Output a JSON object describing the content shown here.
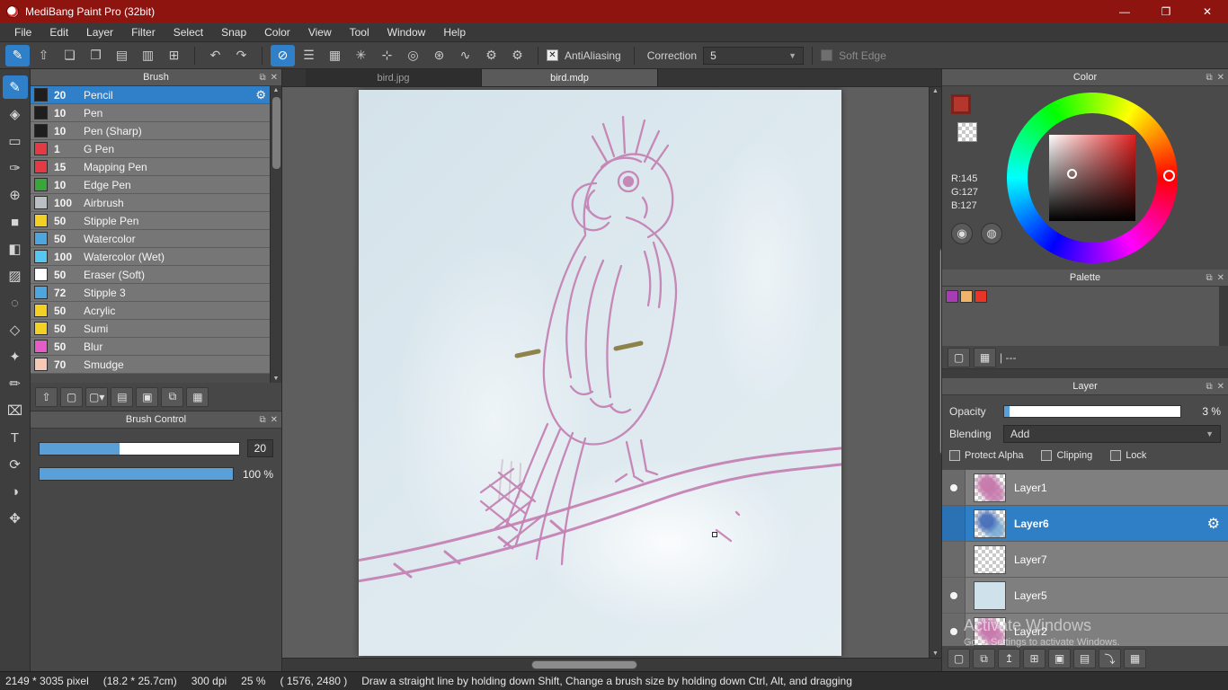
{
  "window": {
    "title": "MediBang Paint Pro (32bit)",
    "controls": {
      "minimize": "—",
      "maximize": "❐",
      "close": "✕"
    }
  },
  "menu": {
    "items": [
      "File",
      "Edit",
      "Layer",
      "Filter",
      "Select",
      "Snap",
      "Color",
      "View",
      "Tool",
      "Window",
      "Help"
    ]
  },
  "toolbar": {
    "left_icons": [
      {
        "name": "paint-icon",
        "glyph": "✎",
        "selected": true
      },
      {
        "name": "upload-icon",
        "glyph": "⇧"
      },
      {
        "name": "comment-icon",
        "glyph": "❏"
      },
      {
        "name": "chat-icon",
        "glyph": "❐"
      },
      {
        "name": "page-icon",
        "glyph": "▤"
      },
      {
        "name": "pages-icon",
        "glyph": "▥"
      },
      {
        "name": "table-icon",
        "glyph": "⊞"
      }
    ],
    "undo_icon": {
      "name": "undo-icon",
      "glyph": "↶"
    },
    "redo_icon": {
      "name": "redo-icon",
      "glyph": "↷"
    },
    "snap_icons": [
      {
        "name": "snap-off-icon",
        "glyph": "⊘",
        "selected": true
      },
      {
        "name": "snap-parallel-icon",
        "glyph": "☰"
      },
      {
        "name": "snap-grid-icon",
        "glyph": "▦"
      },
      {
        "name": "snap-cross-icon",
        "glyph": "✳"
      },
      {
        "name": "snap-vanishing-icon",
        "glyph": "⊹"
      },
      {
        "name": "snap-concentric-icon",
        "glyph": "◎"
      },
      {
        "name": "snap-radial-icon",
        "glyph": "⊛"
      },
      {
        "name": "snap-curve-icon",
        "glyph": "∿"
      },
      {
        "name": "snap-gear-icon",
        "glyph": "⚙"
      },
      {
        "name": "snap-settings-icon",
        "glyph": "⚙"
      }
    ],
    "antialiasing_label": "AntiAliasing",
    "antialiasing_checked": "✕",
    "correction_label": "Correction",
    "correction_value": "5",
    "soft_edge_label": "Soft Edge"
  },
  "toolstrip": {
    "tools": [
      {
        "name": "pen-tool",
        "glyph": "✎",
        "selected": true
      },
      {
        "name": "eraser-tool",
        "glyph": "◈"
      },
      {
        "name": "select-marquee-tool",
        "glyph": "▭"
      },
      {
        "name": "brush-tool",
        "glyph": "✑"
      },
      {
        "name": "move-tool",
        "glyph": "⊕"
      },
      {
        "name": "fill-rect-tool",
        "glyph": "■"
      },
      {
        "name": "bucket-tool",
        "glyph": "◧"
      },
      {
        "name": "gradient-tool",
        "glyph": "▨"
      },
      {
        "name": "select-lasso-tool",
        "glyph": "◌"
      },
      {
        "name": "select-polygon-tool",
        "glyph": "◇"
      },
      {
        "name": "magic-wand-tool",
        "glyph": "✦"
      },
      {
        "name": "select-pen-tool",
        "glyph": "✏"
      },
      {
        "name": "select-eraser-tool",
        "glyph": "⌧"
      },
      {
        "name": "text-tool",
        "glyph": "T"
      },
      {
        "name": "rotate-tool",
        "glyph": "⟳"
      },
      {
        "name": "eyedropper-tool",
        "glyph": "◑"
      },
      {
        "name": "hand-tool",
        "glyph": "✥"
      }
    ]
  },
  "tabs": [
    {
      "label": "bird.jpg",
      "active": false
    },
    {
      "label": "bird.mdp",
      "active": true
    }
  ],
  "brush_panel": {
    "title": "Brush",
    "brushes": [
      {
        "size": "20",
        "name": "Pencil",
        "color": "#1e1e1e",
        "selected": true
      },
      {
        "size": "10",
        "name": "Pen",
        "color": "#1e1e1e"
      },
      {
        "size": "10",
        "name": "Pen (Sharp)",
        "color": "#1e1e1e"
      },
      {
        "size": "1",
        "name": "G Pen",
        "color": "#e23b46"
      },
      {
        "size": "15",
        "name": "Mapping Pen",
        "color": "#e23b46"
      },
      {
        "size": "10",
        "name": "Edge Pen",
        "color": "#3aa53a"
      },
      {
        "size": "100",
        "name": "Airbrush",
        "color": "#b9bfc3"
      },
      {
        "size": "50",
        "name": "Stipple Pen",
        "color": "#f2d024"
      },
      {
        "size": "50",
        "name": "Watercolor",
        "color": "#4da6dd"
      },
      {
        "size": "100",
        "name": "Watercolor (Wet)",
        "color": "#56c7ef"
      },
      {
        "size": "50",
        "name": "Eraser (Soft)",
        "color": "#ffffff"
      },
      {
        "size": "72",
        "name": "Stipple 3",
        "color": "#4da6dd"
      },
      {
        "size": "50",
        "name": "Acrylic",
        "color": "#f2d024"
      },
      {
        "size": "50",
        "name": "Sumi",
        "color": "#f2d024"
      },
      {
        "size": "50",
        "name": "Blur",
        "color": "#e45cc8"
      },
      {
        "size": "70",
        "name": "Smudge",
        "color": "#f6c9b6"
      }
    ],
    "tool_icons": [
      {
        "name": "cloud-upload-brush-icon",
        "glyph": "⇧"
      },
      {
        "name": "add-brush-icon",
        "glyph": "▢"
      },
      {
        "name": "add-brush-dropdown-icon",
        "glyph": "▢▾"
      },
      {
        "name": "edit-brush-icon",
        "glyph": "▤"
      },
      {
        "name": "brush-folder-icon",
        "glyph": "▣"
      },
      {
        "name": "duplicate-brush-icon",
        "glyph": "⧉"
      },
      {
        "name": "delete-brush-icon",
        "glyph": "▦"
      }
    ]
  },
  "brush_control": {
    "title": "Brush Control",
    "size_value": "20",
    "opacity_value": "100 %"
  },
  "color_panel": {
    "title": "Color",
    "r": "R:145",
    "g": "G:127",
    "b": "B:127",
    "buttons": [
      {
        "name": "color-palette-icon",
        "glyph": "◉"
      },
      {
        "name": "color-palette-add-icon",
        "glyph": "◍"
      }
    ]
  },
  "palette_panel": {
    "title": "Palette",
    "swatches": [
      "#a83cb4",
      "#efb469",
      "#e93428"
    ],
    "footer_text": "| ---",
    "buttons": [
      {
        "name": "palette-add-icon",
        "glyph": "▢"
      },
      {
        "name": "palette-delete-icon",
        "glyph": "▦"
      }
    ]
  },
  "layer_panel": {
    "title": "Layer",
    "opacity_label": "Opacity",
    "opacity_value": "3 %",
    "blending_label": "Blending",
    "blending_value": "Add",
    "checkboxes": [
      "Protect Alpha",
      "Clipping",
      "Lock"
    ],
    "layers": [
      {
        "name": "Layer1",
        "visible": true,
        "selected": false,
        "thumb": "pink"
      },
      {
        "name": "Layer6",
        "visible": false,
        "selected": true,
        "thumb": "blue"
      },
      {
        "name": "Layer7",
        "visible": false,
        "selected": false,
        "thumb": "plain"
      },
      {
        "name": "Layer5",
        "visible": true,
        "selected": false,
        "thumb": "solid"
      },
      {
        "name": "Layer2",
        "visible": true,
        "selected": false,
        "thumb": "pink"
      }
    ],
    "tool_icons": [
      {
        "name": "add-layer-icon",
        "glyph": "▢"
      },
      {
        "name": "duplicate-layer-icon",
        "glyph": "⧉"
      },
      {
        "name": "layer-up-icon",
        "glyph": "↥"
      },
      {
        "name": "layer-add-menu-icon",
        "glyph": "⊞"
      },
      {
        "name": "layer-folder-icon",
        "glyph": "▣"
      },
      {
        "name": "copy-layer-icon",
        "glyph": "▤"
      },
      {
        "name": "merge-layer-icon",
        "glyph": "⤵"
      },
      {
        "name": "delete-layer-icon",
        "glyph": "▦"
      }
    ]
  },
  "watermark": {
    "line1": "Activate Windows",
    "line2": "Go to Settings to activate Windows."
  },
  "status_bar": {
    "segments": [
      "2149 * 3035 pixel",
      "(18.2 * 25.7cm)",
      "300 dpi",
      "25 %",
      "( 1576, 2480 )",
      "Draw a straight line by holding down Shift, Change a brush size by holding down Ctrl, Alt, and dragging"
    ]
  },
  "colors": {
    "accent": "#2f80c8",
    "titlebar": "#8e1410",
    "current_color": "#917f7f"
  }
}
